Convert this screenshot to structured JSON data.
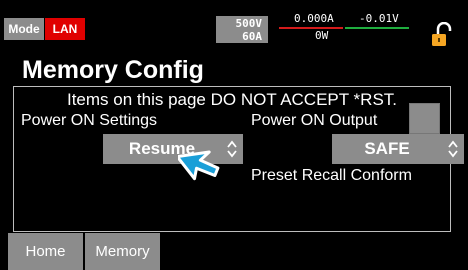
{
  "status": {
    "mode_label": "Mode",
    "lan_label": "LAN",
    "rating_voltage": "500V",
    "rating_current": "60A",
    "measured_current": "0.000A",
    "measured_voltage": "-0.01V",
    "measured_power": "0W",
    "lock_icon": "lock-icon",
    "colors": {
      "lan": "#e00000",
      "current_rule": "#d41b1b",
      "voltage_rule": "#1fae3f",
      "lock": "#f5a623"
    }
  },
  "page": {
    "title": "Memory Config",
    "notice": "Items on this page DO NOT ACCEPT *RST."
  },
  "settings": {
    "power_on_settings_label": "Power ON Settings",
    "power_on_settings_value": "Resume",
    "power_on_output_label": "Power ON Output",
    "power_on_output_value": "SAFE",
    "preset_recall_label": "Preset Recall Conform",
    "preset_recall_checked": false
  },
  "tabs": [
    {
      "label": "Home"
    },
    {
      "label": "Memory"
    }
  ],
  "cursor_icon": "pointer-arrow-icon"
}
